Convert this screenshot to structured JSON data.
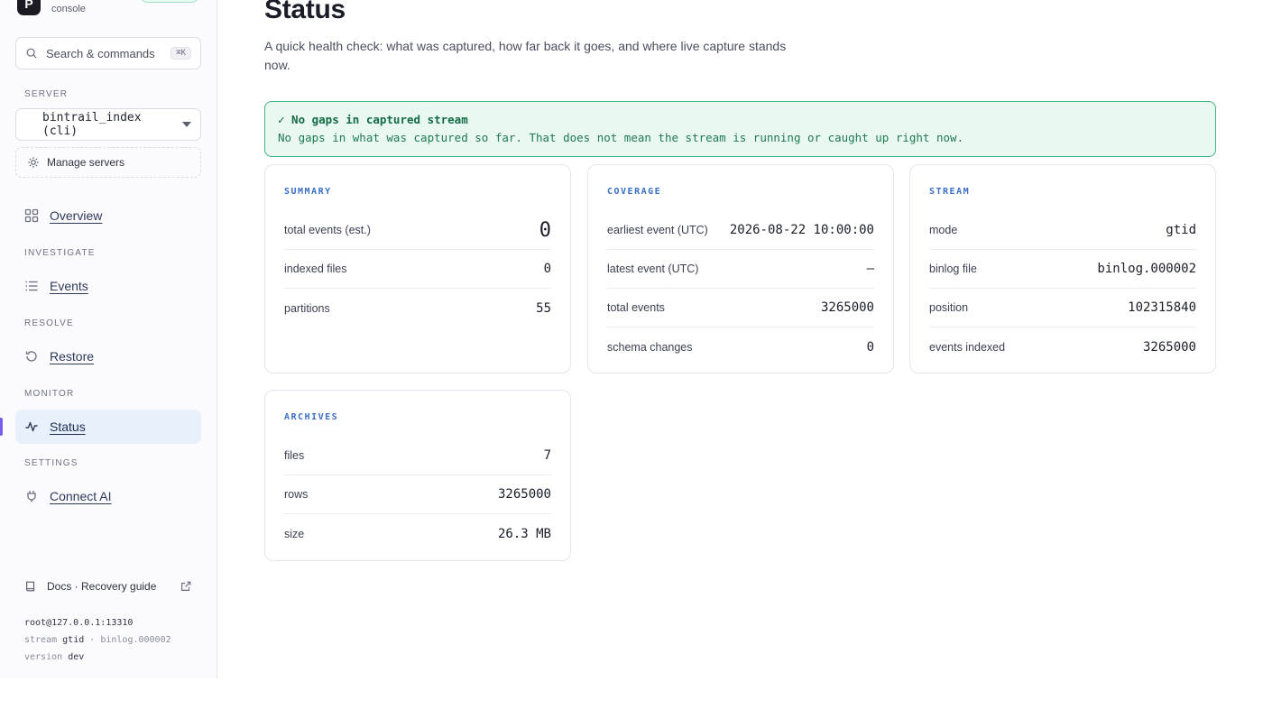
{
  "app": {
    "logo_letter": "P",
    "subtitle": "console"
  },
  "sidebar": {
    "search": {
      "label": "Search & commands",
      "shortcut": "⌘K"
    },
    "server_section": "SERVER",
    "server_selected": "bintrail_index (cli)",
    "manage_servers": "Manage servers",
    "nav": {
      "overview": "Overview",
      "investigate_section": "INVESTIGATE",
      "events": "Events",
      "resolve_section": "RESOLVE",
      "restore": "Restore",
      "monitor_section": "MONITOR",
      "status": "Status",
      "settings_section": "SETTINGS",
      "connect_ai": "Connect AI"
    },
    "docs": "Docs · Recovery guide",
    "footer": {
      "connection": "root@127.0.0.1:13310",
      "stream_label": "stream",
      "stream_mode": "gtid",
      "separator": "·",
      "binlog": "binlog.000002",
      "version_label": "version",
      "version_value": "dev"
    }
  },
  "main": {
    "title": "Status",
    "description": "A quick health check: what was captured, how far back it goes, and where live capture stands now.",
    "banner": {
      "title": "✓ No gaps in captured stream",
      "message": "No gaps in what was captured so far. That does not mean the stream is running or caught up right now."
    },
    "cards": {
      "summary": {
        "title": "SUMMARY",
        "rows": [
          {
            "label": "total events (est.)",
            "value": "0"
          },
          {
            "label": "indexed files",
            "value": "0"
          },
          {
            "label": "partitions",
            "value": "55"
          }
        ]
      },
      "coverage": {
        "title": "COVERAGE",
        "rows": [
          {
            "label": "earliest event (UTC)",
            "value": "2026-08-22 10:00:00"
          },
          {
            "label": "latest event (UTC)",
            "value": "—"
          },
          {
            "label": "total events",
            "value": "3265000"
          },
          {
            "label": "schema changes",
            "value": "0"
          }
        ]
      },
      "stream": {
        "title": "STREAM",
        "rows": [
          {
            "label": "mode",
            "value": "gtid"
          },
          {
            "label": "binlog file",
            "value": "binlog.000002"
          },
          {
            "label": "position",
            "value": "102315840"
          },
          {
            "label": "events indexed",
            "value": "3265000"
          }
        ]
      },
      "archives": {
        "title": "ARCHIVES",
        "rows": [
          {
            "label": "files",
            "value": "7"
          },
          {
            "label": "rows",
            "value": "3265000"
          },
          {
            "label": "size",
            "value": "26.3 MB"
          }
        ]
      }
    }
  },
  "colors": {
    "accent": "#7b5cf0",
    "success": "#3fb683",
    "card_title": "#3a6fc4"
  }
}
